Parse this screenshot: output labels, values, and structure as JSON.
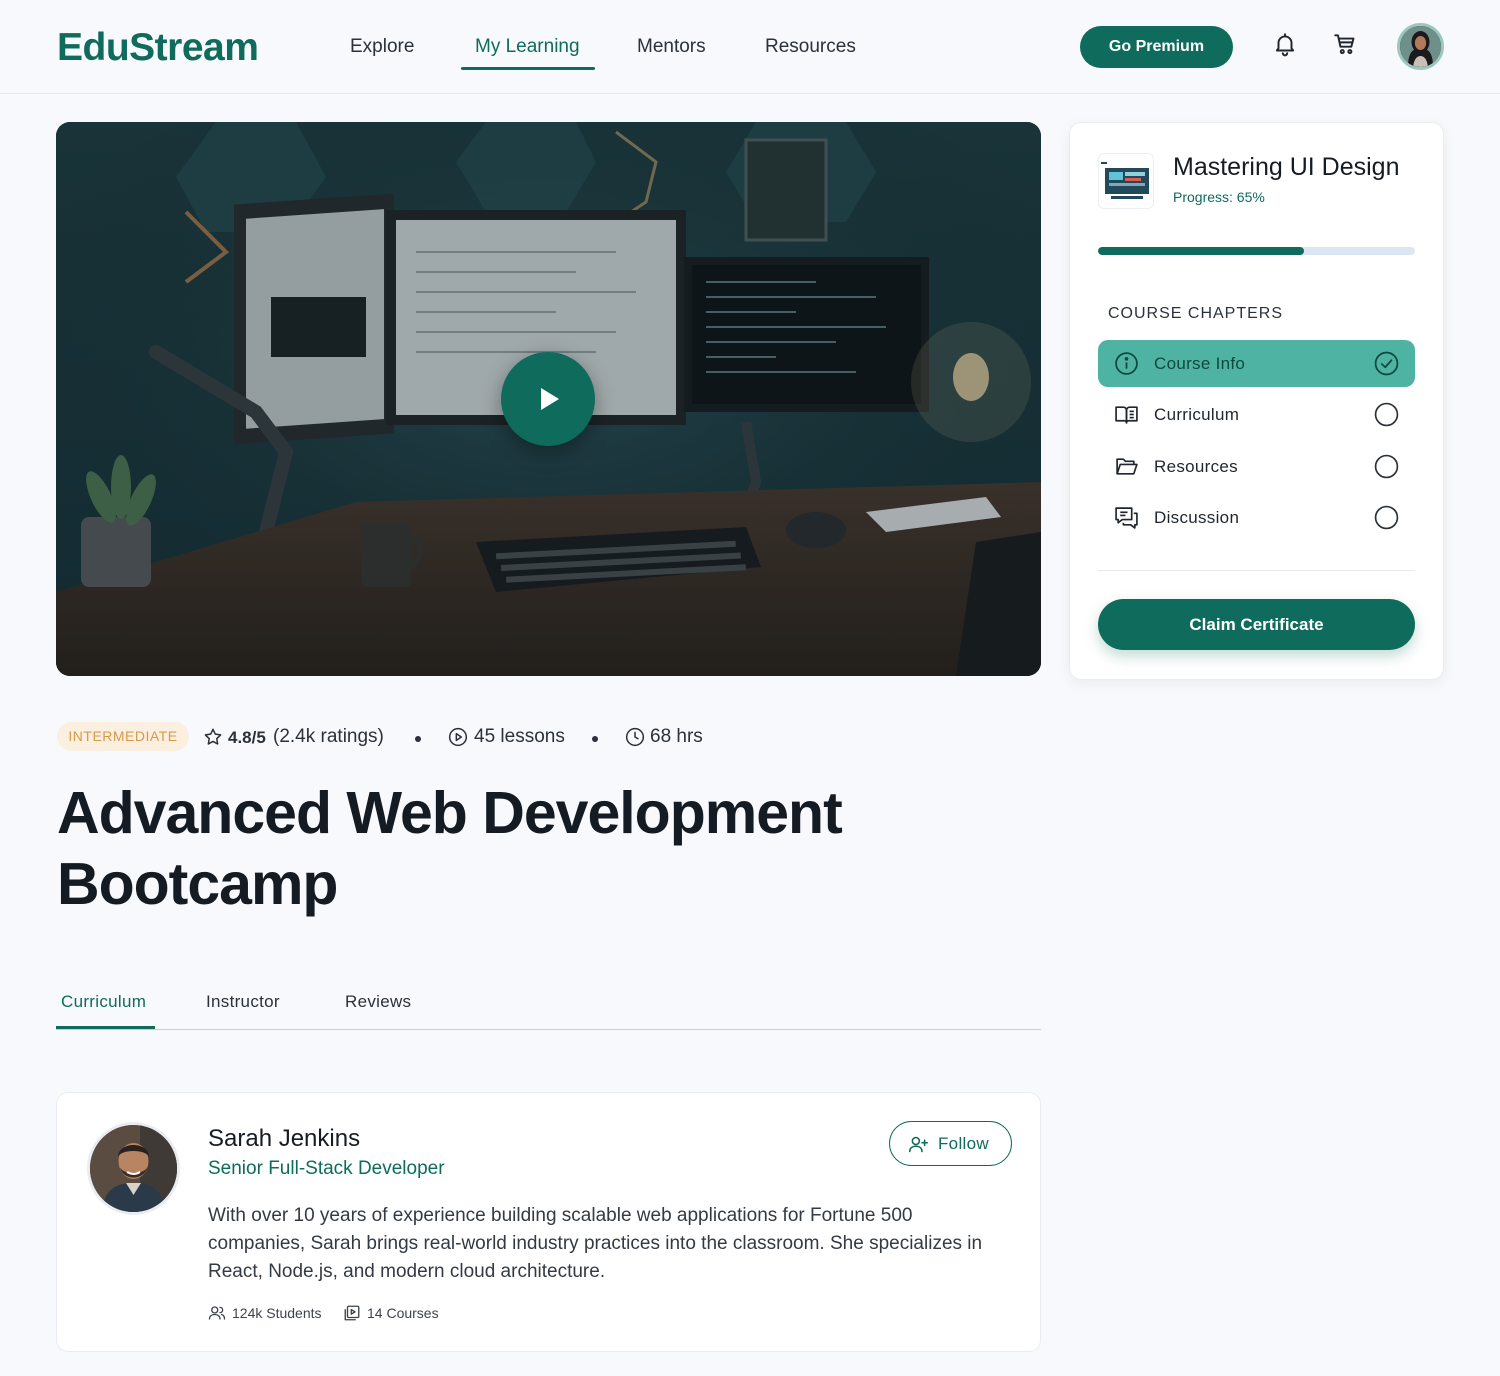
{
  "brand": {
    "logo_text": "EduStream",
    "accent": "#0f6b5c",
    "accent_light": "#4fb3a3"
  },
  "nav": {
    "links": [
      {
        "label": "Explore",
        "active": false
      },
      {
        "label": "My Learning",
        "active": true
      },
      {
        "label": "Mentors",
        "active": false
      },
      {
        "label": "Resources",
        "active": false
      }
    ],
    "premium_label": "Go Premium",
    "icons": [
      "bell-icon",
      "cart-icon",
      "user-avatar"
    ]
  },
  "hero": {
    "icon": "play-icon"
  },
  "sidebar": {
    "course_title": "Mastering UI Design",
    "progress_label": "Progress: 65%",
    "progress_value": 0.65,
    "chapters_heading": "COURSE CHAPTERS",
    "chapters": [
      {
        "label": "Course Info",
        "icon": "info-icon",
        "completed": true,
        "active": true
      },
      {
        "label": "Curriculum",
        "icon": "book-open-icon",
        "completed": false,
        "active": false
      },
      {
        "label": "Resources",
        "icon": "folder-open-icon",
        "completed": false,
        "active": false
      },
      {
        "label": "Discussion",
        "icon": "chat-icon",
        "completed": false,
        "active": false
      }
    ],
    "claim_label": "Claim Certificate"
  },
  "meta": {
    "level": "INTERMEDIATE",
    "rating": "4.8/5",
    "ratings_count": "(2.4k ratings)",
    "lessons": "45 lessons",
    "duration": "68 hrs"
  },
  "course": {
    "title_line1": "Advanced Web Development",
    "title_line2": "Bootcamp"
  },
  "tabs": [
    {
      "label": "Curriculum",
      "active": true
    },
    {
      "label": "Instructor",
      "active": false
    },
    {
      "label": "Reviews",
      "active": false
    }
  ],
  "instructor": {
    "name": "Sarah Jenkins",
    "role": "Senior Full-Stack Developer",
    "bio": "With over 10 years of experience building scalable web applications for Fortune 500 companies, Sarah brings real-world industry practices into the classroom. She specializes in React, Node.js, and modern cloud architecture.",
    "follow_label": "Follow",
    "students": "124k Students",
    "courses": "14 Courses"
  }
}
